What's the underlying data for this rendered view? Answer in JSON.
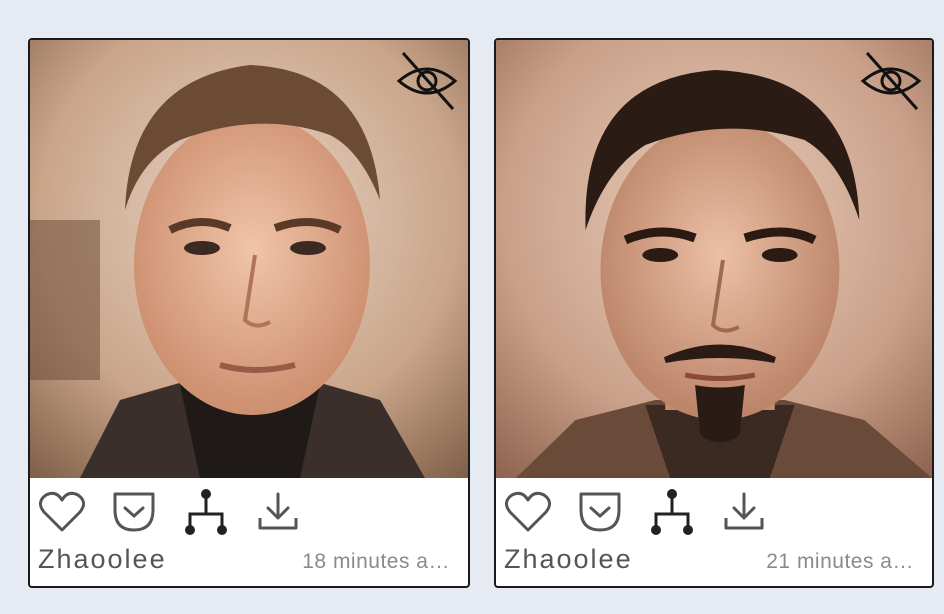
{
  "cards": [
    {
      "author": "Zhaoolee",
      "time": "18 minutes a…",
      "image_alt": "Portrait of a man with light brown hair and dark turtleneck",
      "icons": [
        "eye-slash-icon",
        "heart-icon",
        "pocket-icon",
        "fork-icon",
        "download-icon"
      ]
    },
    {
      "author": "Zhaoolee",
      "time": "21 minutes a…",
      "image_alt": "Portrait of a man with dark hair and goatee",
      "icons": [
        "eye-slash-icon",
        "heart-icon",
        "pocket-icon",
        "fork-icon",
        "download-icon"
      ]
    }
  ],
  "colors": {
    "background": "#e6ebf3",
    "card_border": "#1a1a1a",
    "icon": "#555555",
    "author_text": "#555555",
    "time_text": "#8a8a8a"
  }
}
